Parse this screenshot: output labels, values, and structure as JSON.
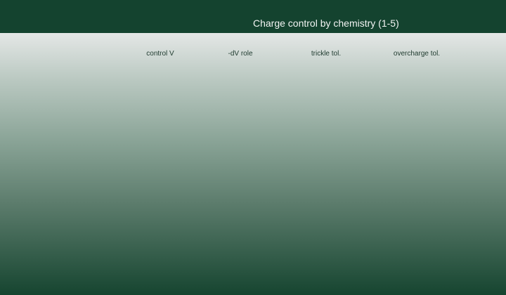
{
  "chart_data": {
    "type": "heatmap",
    "title": "Charge control by chemistry (1-5)",
    "columns": [
      "control V",
      "-dV role",
      "trickle tol.",
      "overcharge tol."
    ],
    "rows": [],
    "values": [],
    "colors": {
      "header_bg": "#14432f",
      "title_text": "#f2f4f3",
      "label_text": "#1e3a2e",
      "gradient_top": "#e4e7e6",
      "gradient_bottom": "#164530"
    }
  }
}
